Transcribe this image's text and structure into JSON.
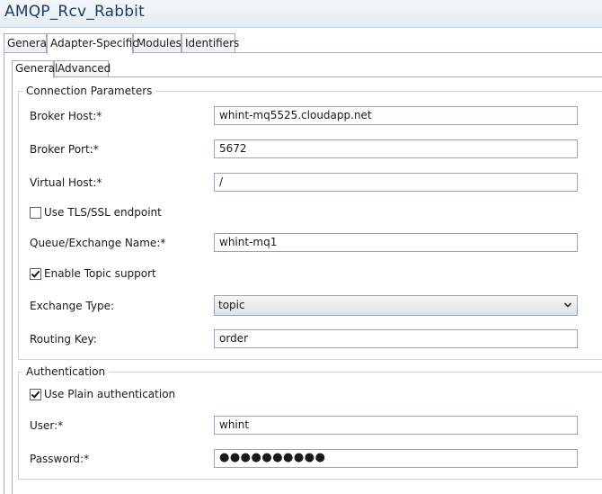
{
  "window": {
    "title": "AMQP_Rcv_Rabbit"
  },
  "outer_tabs": [
    "General",
    "Adapter-Specific",
    "Modules",
    "Identifiers"
  ],
  "inner_tabs": [
    "General",
    "Advanced"
  ],
  "connection": {
    "legend": "Connection Parameters",
    "broker_host_label": "Broker Host:*",
    "broker_host_value": "whint-mq5525.cloudapp.net",
    "broker_port_label": "Broker Port:*",
    "broker_port_value": "5672",
    "virtual_host_label": "Virtual Host:*",
    "virtual_host_value": "/",
    "tls_label": "Use TLS/SSL endpoint",
    "tls_checked": false,
    "queue_label": "Queue/Exchange Name:*",
    "queue_value": "whint-mq1",
    "topic_label": "Enable Topic support",
    "topic_checked": true,
    "exchange_type_label": "Exchange Type:",
    "exchange_type_value": "topic",
    "routing_key_label": "Routing Key:",
    "routing_key_value": "order"
  },
  "auth": {
    "legend": "Authentication",
    "plain_label": "Use Plain authentication",
    "plain_checked": true,
    "user_label": "User:*",
    "user_value": "whint",
    "password_label": "Password:*",
    "password_value": "●●●●●●●●●●"
  },
  "icons": {
    "checkmark": "checkmark-icon",
    "dropdown": "chevron-down-icon"
  }
}
